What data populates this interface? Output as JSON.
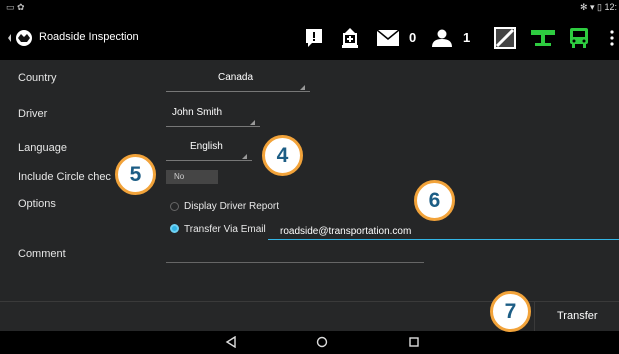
{
  "status_bar": {
    "left_icons": "▭ ✿",
    "right_text": "✻ ▾ ▯ 12:"
  },
  "app": {
    "title": "Roadside Inspection"
  },
  "toolbar": {
    "messages_count": "0",
    "users_count": "1"
  },
  "form": {
    "country_label": "Country",
    "country_value": "Canada",
    "driver_label": "Driver",
    "driver_value": "John Smith",
    "language_label": "Language",
    "language_value": "English",
    "include_circle_label": "Include Circle chec",
    "include_circle_value": "No",
    "options_label": "Options",
    "option_display_report": "Display Driver Report",
    "option_transfer_email": "Transfer Via Email",
    "email_value": "roadside@transportation.com",
    "comment_label": "Comment"
  },
  "actions": {
    "transfer_label": "Transfer"
  },
  "callouts": {
    "c4": "4",
    "c5": "5",
    "c6": "6",
    "c7": "7"
  },
  "colors": {
    "accent": "#33b5e5",
    "badge_border": "#f2a33a",
    "badge_text": "#1c5d85",
    "icon_green": "#2ecc40"
  },
  "icons": [
    "alert-icon",
    "inspection-icon",
    "mail-icon",
    "user-icon",
    "signal-icon",
    "eld-icon",
    "bus-icon",
    "overflow-icon"
  ]
}
